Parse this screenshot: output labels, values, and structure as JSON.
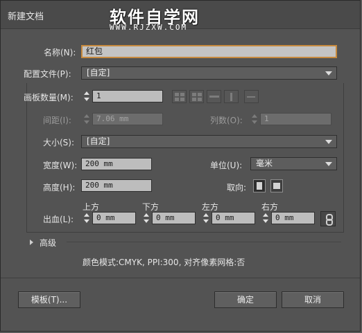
{
  "window": {
    "title": "新建文档"
  },
  "watermark": {
    "title": "软件自学网",
    "url": "WWW.RJZXW.COM"
  },
  "form": {
    "name_label": "名称(N):",
    "name_value": "红包",
    "profile_label": "配置文件(P):",
    "profile_value": "[自定]",
    "artboards_label": "画板数量(M):",
    "artboards_value": "1",
    "spacing_label": "间距(I):",
    "spacing_value": "7.06 mm",
    "columns_label": "列数(O):",
    "columns_value": "1",
    "size_label": "大小(S):",
    "size_value": "[自定]",
    "width_label": "宽度(W):",
    "width_value": "200 mm",
    "units_label": "单位(U):",
    "units_value": "毫米",
    "height_label": "高度(H):",
    "height_value": "200 mm",
    "orientation_label": "取向:",
    "bleed_label": "出血(L):",
    "bleed_top_label": "上方",
    "bleed_top_value": "0 mm",
    "bleed_bottom_label": "下方",
    "bleed_bottom_value": "0 mm",
    "bleed_left_label": "左方",
    "bleed_left_value": "0 mm",
    "bleed_right_label": "右方",
    "bleed_right_value": "0 mm"
  },
  "advanced": {
    "label": "高级",
    "info": "颜色模式:CMYK, PPI:300, 对齐像素网格:否"
  },
  "buttons": {
    "templates": "模板(T)...",
    "ok": "确定",
    "cancel": "取消"
  },
  "icons": {
    "artboard_layout": [
      "grid-by-row-icon",
      "grid-by-column-icon",
      "arrange-by-row-icon",
      "arrange-by-column-icon",
      "right-to-left-icon"
    ],
    "orientation": [
      "portrait-icon",
      "landscape-icon"
    ],
    "bleed_link": "chain-link-icon",
    "advanced_toggle": "disclosure-triangle-icon"
  }
}
